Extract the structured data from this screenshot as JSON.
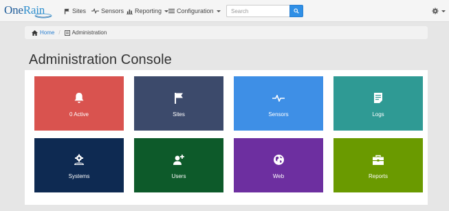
{
  "navbar": {
    "brand": {
      "one": "One",
      "rain": "Rain"
    },
    "items": [
      {
        "label": "Sites",
        "icon": "flag-icon",
        "dropdown": false
      },
      {
        "label": "Sensors",
        "icon": "pulse-icon",
        "dropdown": false
      },
      {
        "label": "Reporting",
        "icon": "chart-icon",
        "dropdown": true
      },
      {
        "label": "Configuration",
        "icon": "list-icon",
        "dropdown": true
      }
    ],
    "search": {
      "placeholder": "Search",
      "value": ""
    },
    "settings_icon": "gear-icon"
  },
  "breadcrumb": {
    "home": "Home",
    "current": "Administration"
  },
  "page": {
    "title": "Administration Console"
  },
  "tiles": [
    {
      "label": "0 Active",
      "icon": "bell-icon",
      "color": "#d9534f"
    },
    {
      "label": "Sites",
      "icon": "flag-icon",
      "color": "#3c4a6b"
    },
    {
      "label": "Sensors",
      "icon": "pulse-icon",
      "color": "#3e8fe6"
    },
    {
      "label": "Logs",
      "icon": "document-icon",
      "color": "#2f9a94"
    },
    {
      "label": "Systems",
      "icon": "cog-user-icon",
      "color": "#0e2a52"
    },
    {
      "label": "Users",
      "icon": "add-user-icon",
      "color": "#0d5a2a"
    },
    {
      "label": "Web",
      "icon": "globe-icon",
      "color": "#6d2fa0"
    },
    {
      "label": "Reports",
      "icon": "briefcase-icon",
      "color": "#6a9a00"
    }
  ]
}
